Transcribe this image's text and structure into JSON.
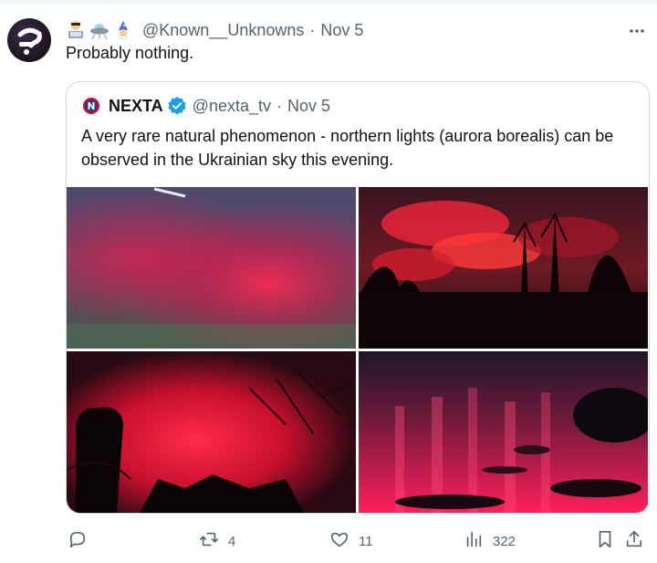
{
  "tweet": {
    "author_emojis": [
      "coder-emoji",
      "ufo-emoji",
      "wizard-emoji"
    ],
    "handle": "@Known__Unknowns",
    "separator": "·",
    "date": "Nov 5",
    "text": "Probably nothing."
  },
  "quote": {
    "name": "NEXTA",
    "handle": "@nexta_tv",
    "separator": "·",
    "date": "Nov 5",
    "text": "A very rare natural phenomenon - northern lights (aurora borealis) can be observed in the Ukrainian sky this evening.",
    "photos": [
      "aurora-photo-1",
      "aurora-photo-2",
      "aurora-photo-3",
      "aurora-photo-4"
    ]
  },
  "actions": {
    "reply_count": "",
    "retweet_count": "4",
    "like_count": "11",
    "views_count": "322"
  },
  "colors": {
    "text_primary": "#0f1419",
    "text_secondary": "#536471",
    "border": "#cfd9de",
    "verified": "#1d9bf0",
    "aurora_red": "#e8123c"
  }
}
